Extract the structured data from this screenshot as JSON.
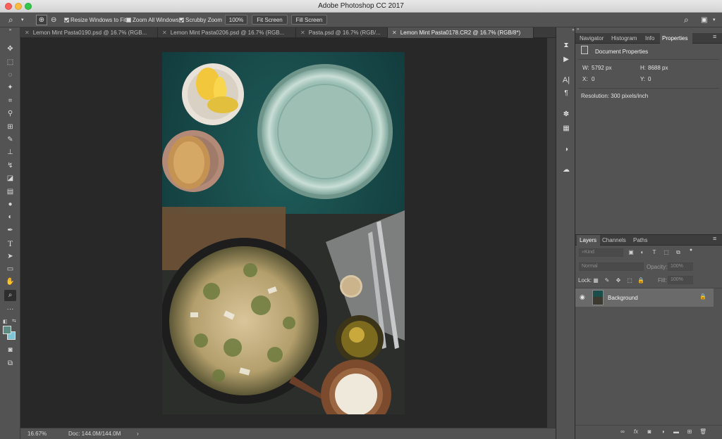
{
  "app": {
    "title": "Adobe Photoshop CC 2017"
  },
  "options_bar": {
    "resize_windows": "Resize Windows to Fit",
    "zoom_all_windows": "Zoom All Windows",
    "scrubby_zoom": "Scrubby Zoom",
    "zoom_value": "100%",
    "fit_screen": "Fit Screen",
    "fill_screen": "Fill Screen"
  },
  "documents": {
    "tabs": [
      {
        "label": "Lemon Mint Pasta0190.psd @ 16.7% (RGB..."
      },
      {
        "label": "Lemon Mint Pasta0206.psd @ 16.7% (RGB..."
      },
      {
        "label": "Pasta.psd @ 16.7% (RGB/..."
      },
      {
        "label": "Lemon Mint Pasta0178.CR2 @ 16.7% (RGB/8*)"
      }
    ]
  },
  "status": {
    "zoom": "16.67%",
    "doc": "Doc: 144.0M/144.0M",
    "arrow": "›"
  },
  "properties_panel": {
    "tabs": [
      "Navigator",
      "Histogram",
      "Info",
      "Properties"
    ],
    "header": "Document Properties",
    "w_label": "W:",
    "w_value": "5792 px",
    "h_label": "H:",
    "h_value": "8688 px",
    "x_label": "X:",
    "x_value": "0",
    "y_label": "Y:",
    "y_value": "0",
    "resolution": "Resolution: 300 pixels/inch"
  },
  "layers_panel": {
    "tabs": [
      "Layers",
      "Channels",
      "Paths"
    ],
    "kind": "Kind",
    "blend_mode": "Normal",
    "opacity_label": "Opacity:",
    "opacity_value": "100%",
    "lock_label": "Lock:",
    "fill_label": "Fill:",
    "fill_value": "100%",
    "layer_name": "Background"
  },
  "colors": {
    "foreground": "#5d8a80",
    "background": "#7fc3d6"
  }
}
